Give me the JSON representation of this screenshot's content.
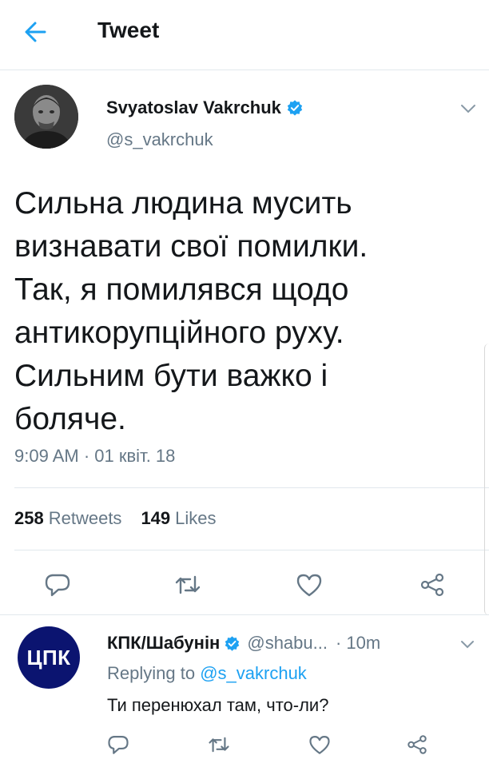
{
  "header": {
    "title": "Tweet",
    "back_icon": "arrow-left-icon",
    "accent_color": "#1da1f2"
  },
  "tweet": {
    "author_name": "Svyatoslav Vakrchuk",
    "author_handle": "@s_vakrchuk",
    "verified": true,
    "text_lines": [
      "Сильна людина мусить",
      "визнавати свої помилки.",
      "Так, я помилявся щодо",
      "антикорупційного руху.",
      "Сильним бути важко і",
      "боляче."
    ],
    "timestamp": "9:09 AM · 01 квіт. 18",
    "retweets_count": "258",
    "retweets_label": "Retweets",
    "likes_count": "149",
    "likes_label": "Likes",
    "actions": [
      "reply-icon",
      "retweet-icon",
      "like-icon",
      "share-icon"
    ]
  },
  "reply": {
    "avatar_text": "ЦПК",
    "author_name": "КПК/Шабунін",
    "verified": true,
    "author_handle": "@shabu...",
    "time": "· 10m",
    "replying_prefix": "Replying to",
    "replying_handle": "@s_vakrchuk",
    "text": "Ти перенюхал там, что-ли?",
    "actions": [
      "reply-icon",
      "retweet-icon",
      "like-icon",
      "share-icon"
    ]
  },
  "colors": {
    "text_primary": "#14171a",
    "text_secondary": "#657786",
    "divider": "#e1e8ed",
    "verified": "#1da1f2",
    "reply_avatar_bg": "#0b1470"
  }
}
